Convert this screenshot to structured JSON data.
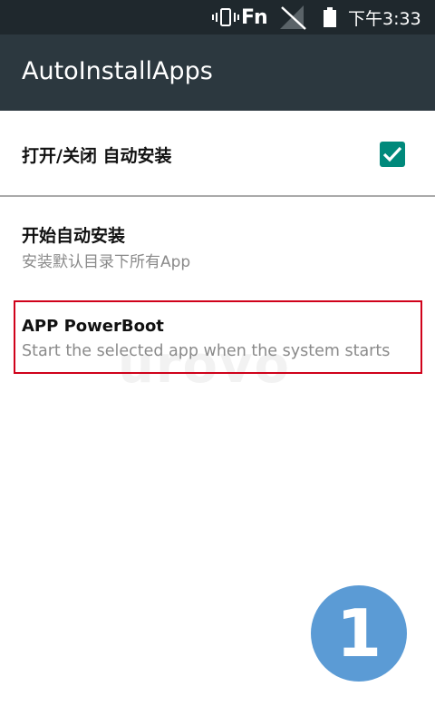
{
  "status_bar": {
    "fn_label": "Fn",
    "time": "下午3:33",
    "icons": [
      "vibrate-icon",
      "no-signal-icon",
      "battery-icon"
    ]
  },
  "app_bar": {
    "title": "AutoInstallApps",
    "background": "#2c383f"
  },
  "preferences": {
    "toggle_auto_install": {
      "title": "打开/关闭 自动安装",
      "checked": true,
      "accent": "#00897b"
    },
    "start_auto_install": {
      "title": "开始自动安装",
      "summary": "安装默认目录下所有App"
    },
    "app_powerboot": {
      "title": "APP PowerBoot",
      "summary": "Start the selected app when the system starts"
    }
  },
  "watermark": {
    "text": "urovo"
  },
  "annotation": {
    "step_number": "1",
    "highlight_color": "#d0021b",
    "badge_color": "#5b9bd5"
  }
}
